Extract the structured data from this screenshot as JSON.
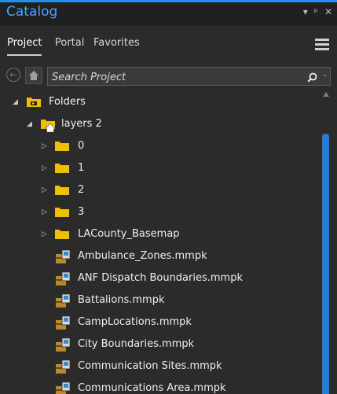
{
  "window": {
    "title": "Catalog",
    "controls": [
      "▾",
      "ᵖ",
      "✕"
    ]
  },
  "tabs": [
    {
      "label": "Project",
      "active": true
    },
    {
      "label": "Portal",
      "active": false
    },
    {
      "label": "Favorites",
      "active": false
    }
  ],
  "search": {
    "placeholder": "Search Project",
    "value": ""
  },
  "tree": {
    "folders_label": "Folders",
    "project_folder": "layers 2",
    "subfolders": [
      "0",
      "1",
      "2",
      "3",
      "LACounty_Basemap"
    ],
    "packages": [
      "Ambulance_Zones.mmpk",
      "ANF Dispatch Boundaries.mmpk",
      "Battalions.mmpk",
      "CampLocations.mmpk",
      "City Boundaries.mmpk",
      "Communication Sites.mmpk",
      "Communications Area.mmpk"
    ]
  },
  "icons": {
    "back": "back-arrow-icon",
    "home": "home-icon",
    "search": "search-icon",
    "menu": "hamburger-menu-icon",
    "folder": "folder-icon",
    "package": "mobile-map-package-icon"
  },
  "colors": {
    "accent": "#2a8fe0",
    "title": "#41a7ff",
    "folder": "#f0c000",
    "package": "#b98a2d"
  }
}
